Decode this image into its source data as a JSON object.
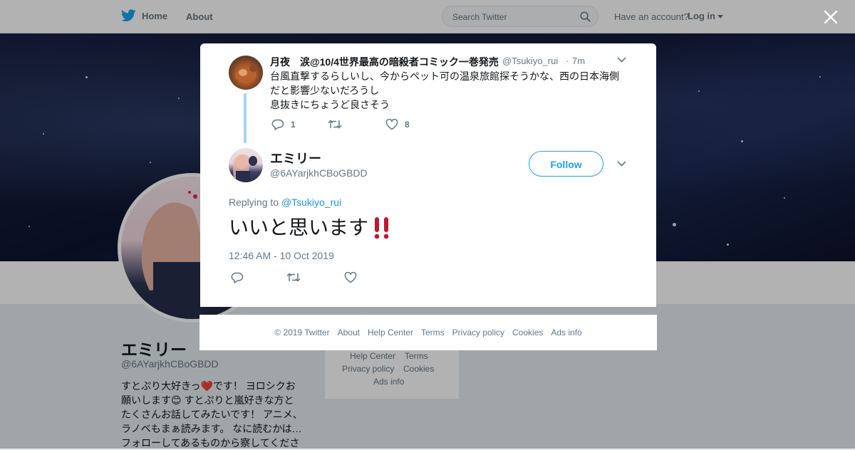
{
  "nav": {
    "home_label": "Home",
    "about_label": "About",
    "search_placeholder": "Search Twitter",
    "account_question": "Have an account?",
    "login_label": "Log in"
  },
  "profile_background": {
    "name": "エミリー",
    "handle": "@6AYarjkhCBoGBDD",
    "bio_lines": [
      "すとぷり大好きっ❤️です！ ヨロシクお",
      "願いします😊 すとぷりと嵐好きな方と",
      "たくさんお話してみたいです！ アニメ、",
      "ラノベもまぁ読みます。 なに読むかは…",
      "フォローしてあるものから察してくださ"
    ],
    "side_links": [
      "Help Center",
      "Terms",
      "Privacy policy",
      "Cookies",
      "Ads info"
    ]
  },
  "parent_tweet": {
    "name": "月夜　涙@10/4世界最高の暗殺者コミック一巻発売",
    "handle": "@Tsukiyo_rui",
    "time": "7m",
    "text_lines": [
      "台風直撃するらしいし、今からペット可の温泉旅館探そうかな、西の日本海側",
      "だと影響少ないだろうし",
      "息抜きにちょうど良さそう"
    ],
    "reply_count": "1",
    "like_count": "8"
  },
  "main_tweet": {
    "name": "エミリー",
    "handle": "@6AYarjkhCBoGBDD",
    "follow_label": "Follow",
    "replying_prefix": "Replying to",
    "replying_to": "@Tsukiyo_rui",
    "text": "いいと思います",
    "emoji": "‼️",
    "timestamp": "12:46 AM - 10 Oct 2019"
  },
  "footer": {
    "copyright": "© 2019 Twitter",
    "links": [
      "About",
      "Help Center",
      "Terms",
      "Privacy policy",
      "Cookies",
      "Ads info"
    ]
  },
  "colors": {
    "twitter_blue": "#1da1f2",
    "link_blue": "#1b95e0",
    "thread_line": "#a5d4f2",
    "secondary_text": "#657786",
    "emphasis_red": "#e0245e"
  },
  "icons": [
    "twitter-bird-icon",
    "search-icon",
    "caret-down-icon",
    "close-icon",
    "chevron-down-icon",
    "reply-icon",
    "retweet-icon",
    "like-icon"
  ]
}
